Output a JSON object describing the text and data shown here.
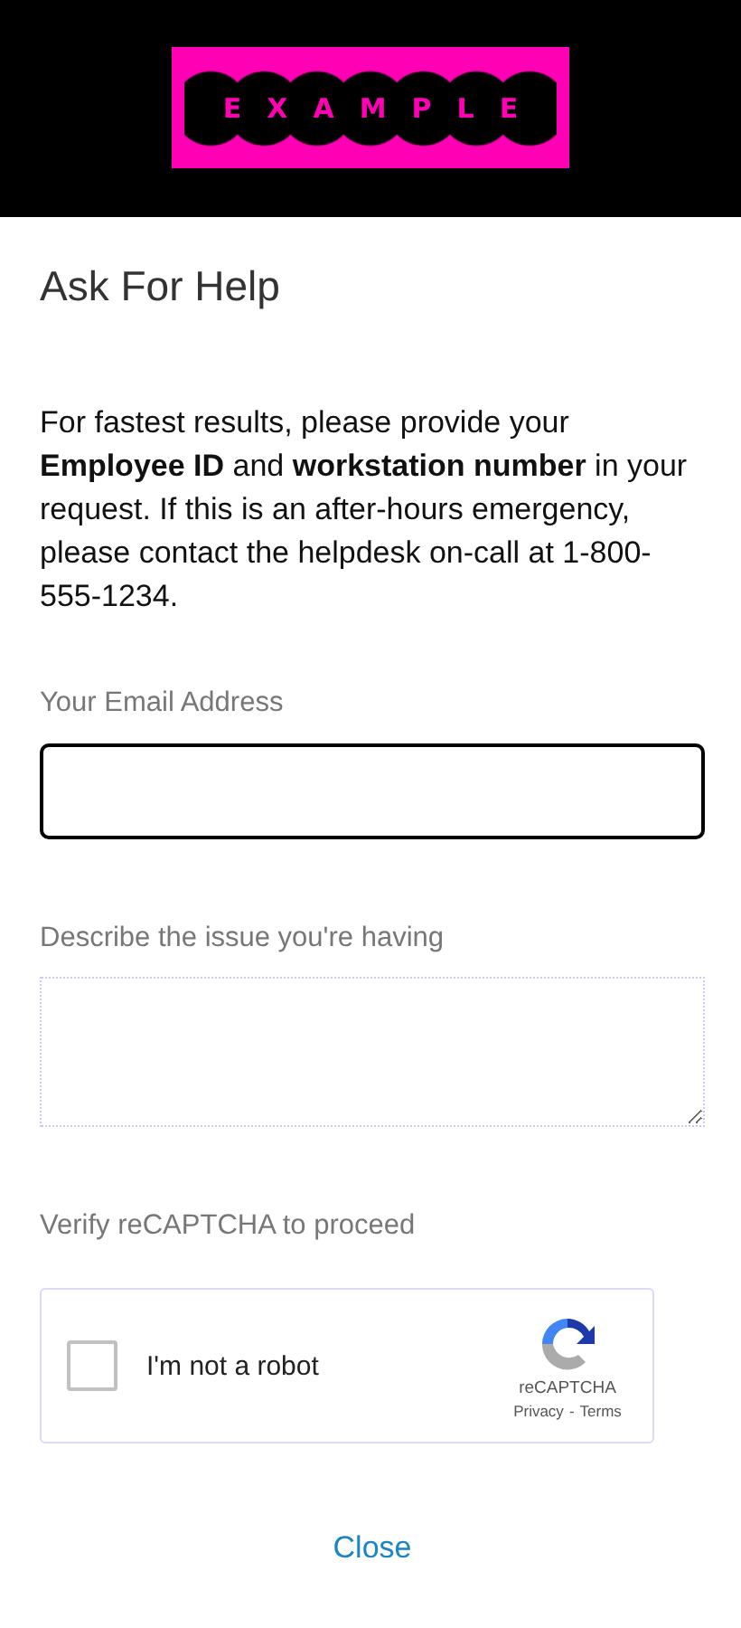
{
  "logo": {
    "text": "EXAMPLE"
  },
  "title": "Ask For Help",
  "intro": "For fastest results, please provide your **Employee ID** and **workstation number** in your request. If this is an after-hours emergency, please contact the helpdesk on-call at 1-800-555-1234.",
  "fields": [
    {
      "kind": "input",
      "label": "Your Email Address",
      "focused": true
    },
    {
      "kind": "textarea",
      "label": "Describe the issue you're having",
      "focused": false
    }
  ],
  "captcha": {
    "label": "Verify reCAPTCHA to proceed",
    "checkbox_label": "I'm not a robot",
    "checked": false,
    "brand": "reCAPTCHA",
    "privacy": "Privacy",
    "separator": "-",
    "terms": "Terms"
  },
  "close": "Close"
}
